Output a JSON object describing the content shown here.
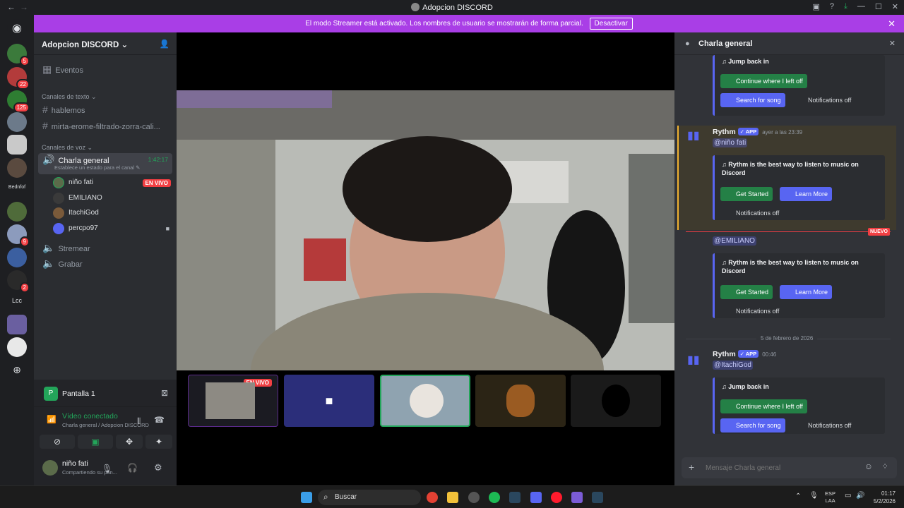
{
  "window": {
    "title": "Adopcion DISCORD"
  },
  "banner": {
    "text": "El modo Streamer está activado. Los nombres de usuario se mostrarán de forma parcial.",
    "button": "Desactivar"
  },
  "guilds": {
    "badges": [
      "5",
      "22",
      "125",
      "9",
      "2"
    ],
    "labels": [
      "Bednfof",
      "Lcc"
    ]
  },
  "server": {
    "name": "Adopcion DISCORD",
    "events": "Eventos",
    "text_category": "Canales de texto",
    "text_channels": [
      "hablemos",
      "mirta-erome-filtrado-zorra-cali..."
    ],
    "voice_category": "Canales de voz",
    "active_voice": {
      "name": "Charla general",
      "timer": "1:42:17",
      "status": "Establece un estado para el canal"
    },
    "voice_users": [
      {
        "name": "niño fati",
        "badge": "EN VIVO"
      },
      {
        "name": "EMILIANO"
      },
      {
        "name": "ItachiGod"
      },
      {
        "name": "percpo97"
      }
    ],
    "other_voice": [
      "Stremear",
      "Grabar"
    ]
  },
  "panel": {
    "stream_title": "Pantalla 1",
    "conn_status": "Vídeo conectado",
    "conn_sub": "Charla general / Adopcion DISCORD",
    "user_name": "niño fati",
    "user_status": "Compartiendo su pan..."
  },
  "stage": {
    "live_badge": "EN VIVO"
  },
  "chat": {
    "channel": "Charla general",
    "messages": [
      {
        "title": "Jump back in",
        "buttons": [
          "Continue where I left off",
          "Search for song",
          "Notifications off"
        ]
      },
      {
        "author": "Rythm",
        "tag": "APP",
        "time": "ayer a las 23:39",
        "mention": "@niño fati",
        "title": "Rythm is the best way to listen to music on Discord",
        "buttons": [
          "Get Started",
          "Learn More",
          "Notifications off"
        ]
      },
      {
        "new_label": "NUEVO",
        "mention": "@EMILIANO",
        "title": "Rythm is the best way to listen to music on Discord",
        "buttons": [
          "Get Started",
          "Learn More",
          "Notifications off"
        ]
      },
      {
        "date": "5 de febrero de 2026",
        "author": "Rythm",
        "tag": "APP",
        "time": "00:46",
        "mention": "@ItachiGod",
        "title": "Jump back in",
        "buttons": [
          "Continue where I left off",
          "Search for song",
          "Notifications off"
        ]
      }
    ],
    "input_placeholder": "Mensaje Charla general"
  },
  "taskbar": {
    "search": "Buscar",
    "lang1": "ESP",
    "lang2": "LAA",
    "time": "01:17",
    "date": "5/2/2026"
  }
}
